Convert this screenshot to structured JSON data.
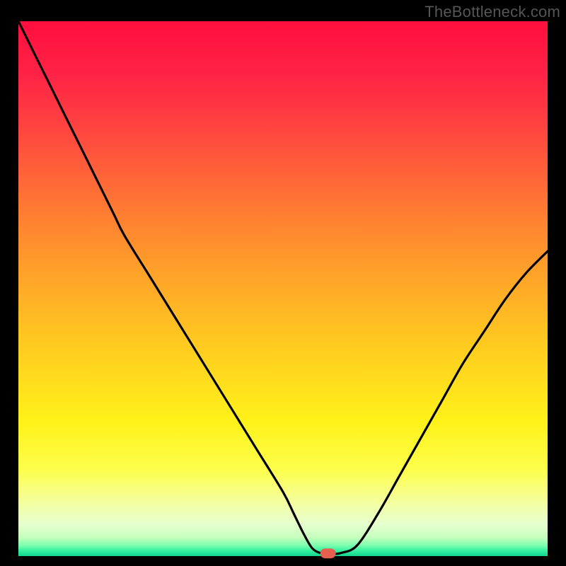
{
  "watermark": "TheBottleneck.com",
  "chart_data": {
    "type": "line",
    "title": "",
    "xlabel": "",
    "ylabel": "",
    "xlim": [
      0,
      100
    ],
    "ylim": [
      0,
      100
    ],
    "x": [
      0,
      3,
      6,
      9,
      12,
      15,
      18,
      20,
      25,
      30,
      35,
      40,
      45,
      50,
      52,
      54,
      55.5,
      57,
      59,
      61,
      64,
      68,
      72,
      76,
      80,
      84,
      88,
      92,
      96,
      100
    ],
    "values": [
      100,
      94,
      88,
      82,
      76,
      70,
      64,
      60,
      52,
      44,
      36,
      28,
      20,
      12,
      8,
      4,
      1.5,
      0.6,
      0.4,
      0.6,
      2,
      8,
      15,
      22,
      29,
      36,
      42,
      48,
      53,
      57
    ],
    "optimum_marker": {
      "x": 58.5,
      "y": 0.5
    },
    "note": "Thin bright-green band sits along the very bottom of the gradient just above the axis line. Curve descends steeply from upper-left, flattens briefly at the bottom near x≈56–60, then rises toward the upper-right at a shallower slope."
  }
}
